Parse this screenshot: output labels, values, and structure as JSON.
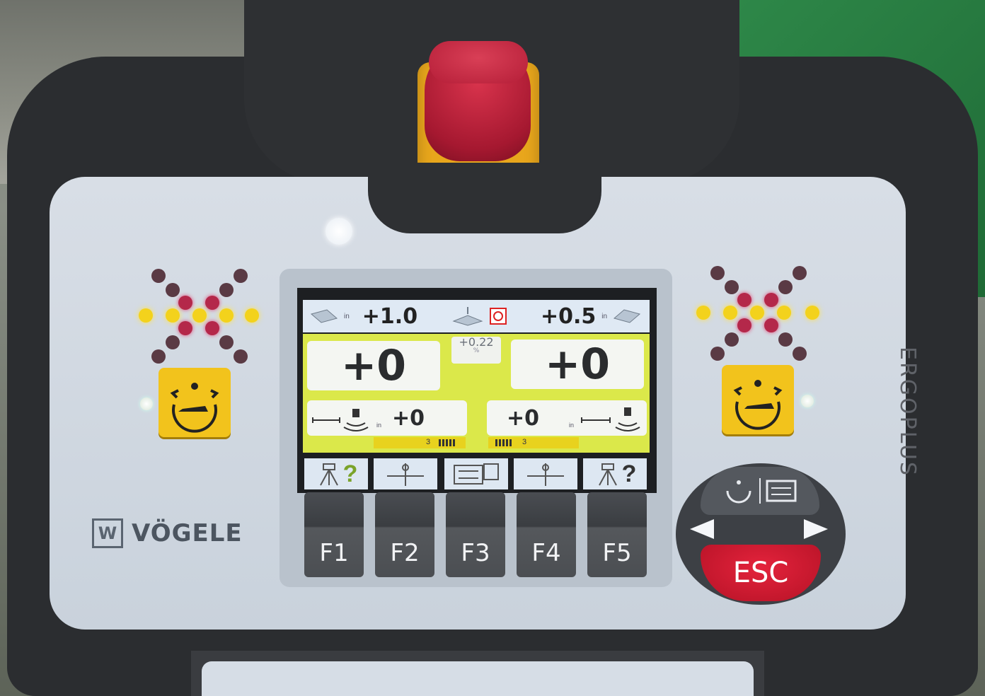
{
  "device": {
    "brand": "VÖGELE",
    "brand_logo": "W",
    "side_text": "ERGOPLUS"
  },
  "screen": {
    "top_left_value": "+1.0",
    "top_left_unit": "in",
    "top_right_value": "+0.5",
    "top_right_unit": "in",
    "mid_value": "+0.22",
    "mid_unit": "%",
    "left_big": "+0",
    "right_big": "+0",
    "left_sensor_value": "+0",
    "left_sensor_unit": "in",
    "right_sensor_value": "+0",
    "right_sensor_unit": "in",
    "left_bar_label": "3",
    "right_bar_label": "3"
  },
  "function_keys": [
    {
      "label": "F1",
      "icon": "tripod-question-icon"
    },
    {
      "label": "F2",
      "icon": "sensor-axis-icon"
    },
    {
      "label": "F3",
      "icon": "settings-sliders-icon"
    },
    {
      "label": "F4",
      "icon": "sensor-axis-icon"
    },
    {
      "label": "F5",
      "icon": "tripod-question-icon"
    }
  ],
  "fkey_symbols": [
    "?",
    "?"
  ],
  "nav": {
    "esc_label": "ESC"
  },
  "colors": {
    "accent_yellow": "#f2c31c",
    "screen_yellow": "#dbe84a",
    "estop_red": "#b51e38",
    "esc_red": "#d11a30"
  }
}
